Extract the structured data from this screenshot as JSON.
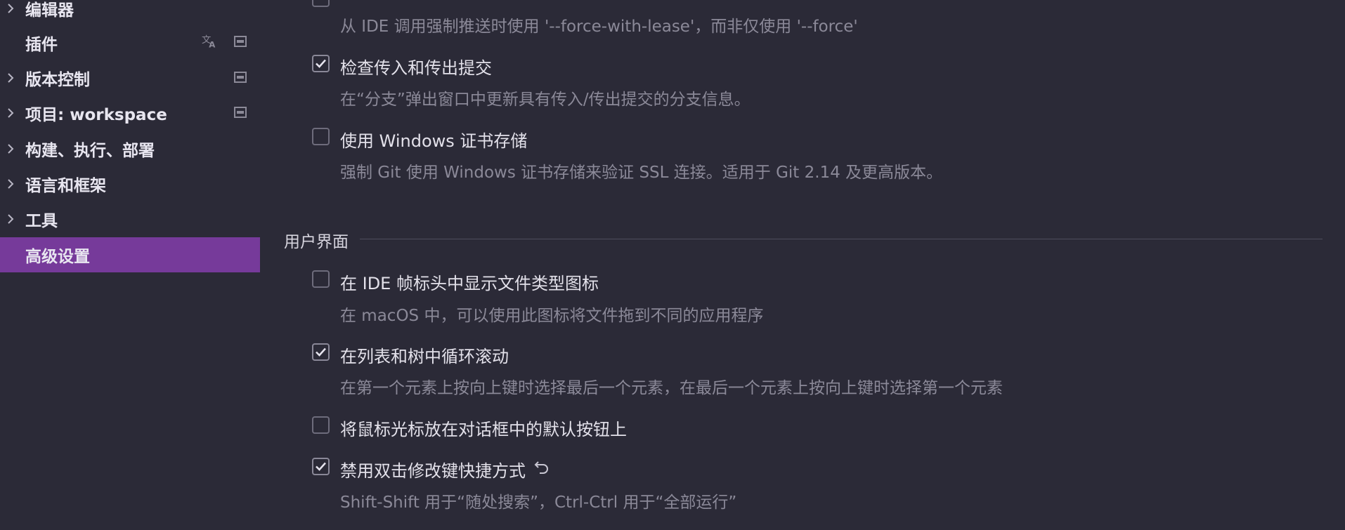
{
  "sidebar": {
    "items": [
      {
        "label": "编辑器",
        "has_chevron": true
      },
      {
        "label": "插件",
        "has_chevron": false
      },
      {
        "label": "版本控制",
        "has_chevron": true
      },
      {
        "label": "项目: workspace",
        "has_chevron": true
      },
      {
        "label": "构建、执行、部署",
        "has_chevron": true
      },
      {
        "label": "语言和框架",
        "has_chevron": true
      },
      {
        "label": "工具",
        "has_chevron": true
      },
      {
        "label": "高级设置",
        "has_chevron": false,
        "selected": true
      }
    ]
  },
  "content": {
    "top_option": {
      "desc": "从 IDE 调用强制推送时使用 '--force-with-lease'，而非仅使用 '--force'"
    },
    "options_vcs": [
      {
        "title": "检查传入和传出提交",
        "desc": "在“分支”弹出窗口中更新具有传入/传出提交的分支信息。",
        "checked": true
      },
      {
        "title": "使用 Windows 证书存储",
        "desc": "强制 Git 使用 Windows 证书存储来验证 SSL 连接。适用于 Git 2.14 及更高版本。",
        "checked": false
      }
    ],
    "section_ui": {
      "title": "用户界面",
      "options": [
        {
          "title": "在 IDE 帧标头中显示文件类型图标",
          "desc": "在 macOS 中，可以使用此图标将文件拖到不同的应用程序",
          "checked": false
        },
        {
          "title": "在列表和树中循环滚动",
          "desc": "在第一个元素上按向上键时选择最后一个元素，在最后一个元素上按向上键时选择第一个元素",
          "checked": true
        },
        {
          "title": "将鼠标光标放在对话框中的默认按钮上",
          "desc": "",
          "checked": false
        },
        {
          "title": "禁用双击修改键快捷方式",
          "desc": "Shift-Shift 用于“随处搜索”，Ctrl-Ctrl 用于“全部运行”",
          "checked": true,
          "has_reset": true
        }
      ]
    }
  },
  "icons": {
    "translate": "translate-icon",
    "settings_scope": "project-scope-icon",
    "chevron": "chevron-right-icon",
    "check": "checkmark-icon",
    "reset": "reset-icon"
  },
  "colors": {
    "background": "#2b2a37",
    "selected": "#763a9a",
    "text": "#e3e1ea",
    "muted": "#8b8998"
  }
}
